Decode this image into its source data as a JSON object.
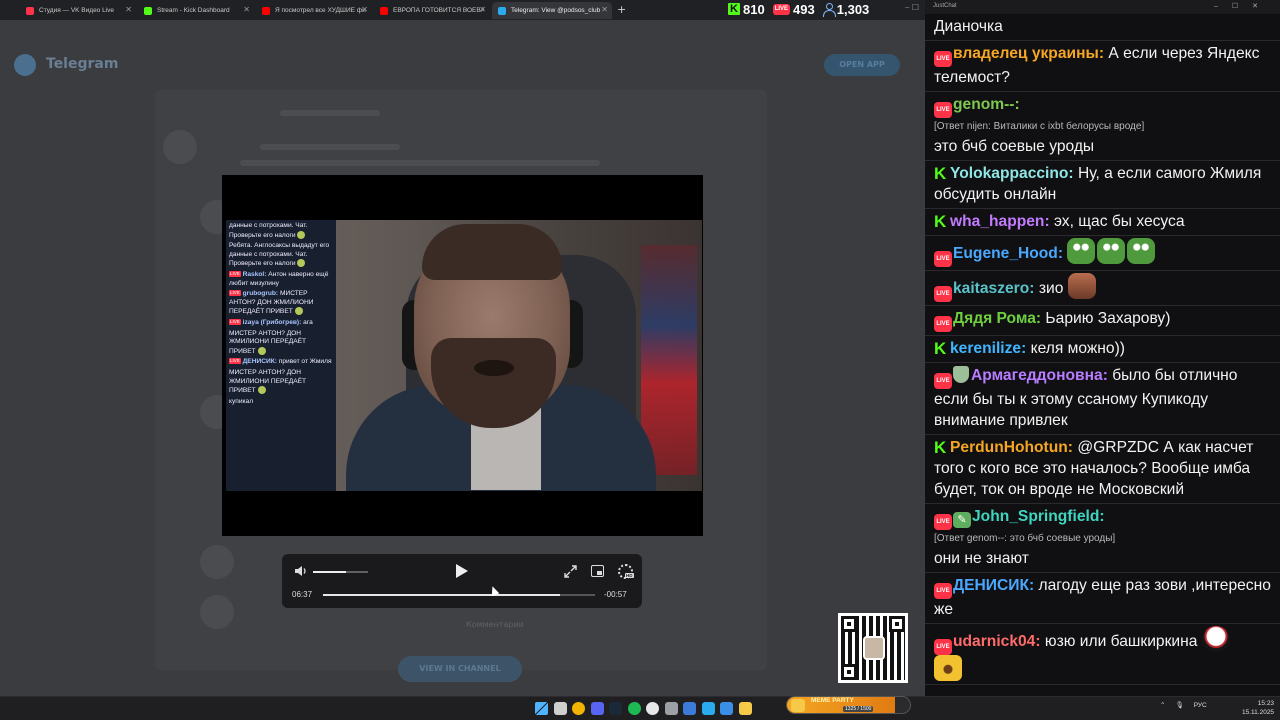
{
  "browser": {
    "tabs": [
      {
        "title": "Студия — VK Видео Live",
        "color": "#ff3347"
      },
      {
        "title": "Stream - Kick Dashboard",
        "color": "#53fc18"
      },
      {
        "title": "Я посмотрел все ХУДШИЕ фи...",
        "color": "#ff0000"
      },
      {
        "title": "ЕВРОПА ГОТОВИТСЯ ВОЕВАТЬ...",
        "color": "#ff0000"
      },
      {
        "title": "Telegram: View @podsos_club",
        "color": "#2aabee"
      }
    ],
    "new_tab_icon": "+"
  },
  "stream_stats": {
    "kick_viewers": "810",
    "vk_viewers": "493",
    "total_viewers": "1,303",
    "live_badge": "LIVE"
  },
  "telegram": {
    "brand": "Telegram",
    "open_app_button": "OPEN APP",
    "comments_label": "Комментарии",
    "view_in_channel": "VIEW IN CHANNEL"
  },
  "video_chat": [
    {
      "nick": "",
      "text": "данные с потрохами. Чат. Проверьте его налоги"
    },
    {
      "nick": "",
      "text": "Ребята. Англосаксы выдадут его данные с потрохами. Чат. Проверьте его налоги"
    },
    {
      "nick": "Raskol:",
      "text": "Антон наверно ещё любит мизулину"
    },
    {
      "nick": "grubogrub:",
      "text": "МИСТЕР АНТОН? ДОН ЖМИЛИОНИ ПЕРЕДАЁТ ПРИВЕТ"
    },
    {
      "nick": "izaya (Грибогрев):",
      "text": "ага"
    },
    {
      "nick": "",
      "text": "МИСТЕР АНТОН? ДОН ЖМИЛИОНИ ПЕРЕДАЁТ ПРИВЕТ"
    },
    {
      "nick": "ДЕНИСИК:",
      "text": "привет от Жмиля"
    },
    {
      "nick": "",
      "text": "МИСТЕР АНТОН? ДОН ЖМИЛИОНИ ПЕРЕДАЁТ ПРИВЕТ"
    },
    {
      "nick": "",
      "text": "купикал"
    }
  ],
  "player": {
    "current_time": "06:37",
    "remaining_time": "-00:57",
    "progress": 0.87,
    "volume": 0.6,
    "quality_badge": "HD"
  },
  "chat_window": {
    "title": "JustChat",
    "messages": [
      {
        "badge": "none",
        "nick": "",
        "nick_color": "#ffffff",
        "reply": "",
        "text": "Дианочка",
        "emotes": []
      },
      {
        "badge": "vk",
        "nick": "владелец украины:",
        "nick_color": "#f5a623",
        "reply": "",
        "text": "А если через Яндекс телемост?",
        "emotes": []
      },
      {
        "badge": "vk",
        "nick": "genom--:",
        "nick_color": "#7ec850",
        "reply": "[Ответ nijen: Виталики с ixbt белорусы вроде]",
        "text": "это бчб соевые уроды",
        "emotes": []
      },
      {
        "badge": "kick",
        "nick": "Yolokappaccino:",
        "nick_color": "#8ee6e6",
        "reply": "",
        "text": "Ну, а если самого Жмиля обсудить онлайн",
        "emotes": []
      },
      {
        "badge": "kick",
        "nick": "wha_happen:",
        "nick_color": "#c27bff",
        "reply": "",
        "text": "эх, щас бы хесуса",
        "emotes": []
      },
      {
        "badge": "vk",
        "nick": "Eugene_Hood:",
        "nick_color": "#4aa8ff",
        "reply": "",
        "text": "",
        "emotes": [
          "frog",
          "frog",
          "frog"
        ]
      },
      {
        "badge": "vk",
        "nick": "kaitaszero:",
        "nick_color": "#59c2c9",
        "reply": "",
        "text": "зио",
        "emotes": [
          "man"
        ]
      },
      {
        "badge": "vk",
        "nick": "Дядя Рома:",
        "nick_color": "#6fcf3f",
        "reply": "",
        "text": "Ьарию Захарову)",
        "emotes": []
      },
      {
        "badge": "kick",
        "nick": "kerenilize:",
        "nick_color": "#3fb6ff",
        "reply": "",
        "text": "келя можно))",
        "emotes": []
      },
      {
        "badge": "vk-shield",
        "nick": "Армагеддоновна:",
        "nick_color": "#b77cff",
        "reply": "",
        "text": "было бы отлично если бы ты к этому ссаному Купикоду внимание привлек",
        "emotes": []
      },
      {
        "badge": "kick",
        "nick": "PerdunHohotun:",
        "nick_color": "#f5a623",
        "reply": "",
        "text": "@GRPZDC А как насчет того с кого все это началось? Вообще имба будет, ток он вроде не Московский",
        "emotes": []
      },
      {
        "badge": "vk-pen",
        "nick": "John_Springfield:",
        "nick_color": "#3fd6c0",
        "reply": "[Ответ genom--: это бчб соевые уроды]",
        "text": "они не знают",
        "emotes": []
      },
      {
        "badge": "vk",
        "nick": "ДЕНИСИК:",
        "nick_color": "#4aa8ff",
        "reply": "",
        "text": "лагоду еще раз зови ,интересно же",
        "emotes": []
      },
      {
        "badge": "vk",
        "nick": "udarnick04:",
        "nick_color": "#ff6b6b",
        "reply": "",
        "text": "юзю или башкиркина",
        "emotes": [
          "joker",
          "yellow"
        ]
      }
    ]
  },
  "meme_party": {
    "label": "MEME PARTY",
    "count": "1325 / 1500",
    "progress": 0.88
  },
  "taskbar": {
    "icons": [
      "windows-start-icon",
      "search-icon",
      "chrome-icon",
      "discord-icon",
      "steam-icon",
      "spotify-icon",
      "obs-icon",
      "app-icon",
      "media-player-icon",
      "telegram-icon",
      "vscode-icon",
      "explorer-icon"
    ],
    "language": "РУС",
    "time": "15:23",
    "date": "15.11.2025"
  }
}
